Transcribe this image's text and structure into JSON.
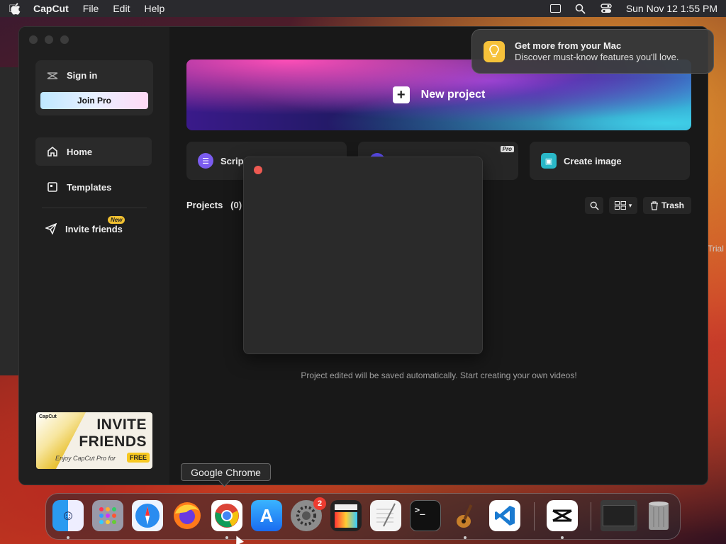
{
  "menubar": {
    "app_name": "CapCut",
    "menus": [
      "File",
      "Edit",
      "Help"
    ],
    "datetime": "Sun Nov 12  1:55 PM"
  },
  "background": {
    "trial_label": "Trial"
  },
  "sidebar": {
    "sign_in": "Sign in",
    "join_pro": "Join Pro",
    "nav": [
      {
        "label": "Home",
        "icon": "home-icon"
      },
      {
        "label": "Templates",
        "icon": "templates-icon"
      },
      {
        "label": "Invite friends",
        "icon": "send-icon",
        "badge": "New"
      }
    ],
    "banner": {
      "brand": "CapCut",
      "line1": "INVITE",
      "line2": "FRIENDS",
      "sub": "Enjoy CapCut Pro for",
      "free": "FREE"
    }
  },
  "main": {
    "new_project": "New project",
    "actions": [
      {
        "label": "Scrip",
        "icon": "script-icon",
        "color": "#7b5cf0"
      },
      {
        "label": "",
        "icon": "ai-icon",
        "color": "#5b4cf0",
        "badge": "Pro"
      },
      {
        "label": "Create image",
        "icon": "image-icon",
        "color": "#2ab8c8"
      }
    ],
    "projects_label": "Projects",
    "projects_count": "(0)",
    "trash": "Trash",
    "empty_text": "Project edited will be saved automatically. Start creating your own videos!"
  },
  "notification": {
    "title": "Get more from your Mac",
    "body": "Discover must-know features you'll love."
  },
  "tooltip": "Google Chrome",
  "dock": {
    "apps": [
      {
        "name": "finder",
        "color": "#2f8cf0"
      },
      {
        "name": "launchpad",
        "color": "#8a8a9a"
      },
      {
        "name": "safari",
        "color": "#3a9af0"
      },
      {
        "name": "firefox",
        "color": "#e86b2a"
      },
      {
        "name": "chrome",
        "color": "#ffffff"
      },
      {
        "name": "app-store",
        "color": "#1a8cf0"
      },
      {
        "name": "system-settings",
        "color": "#8a8a8a",
        "badge": "2"
      },
      {
        "name": "final-cut",
        "color": "#2a2a2a"
      },
      {
        "name": "textedit",
        "color": "#f2f2f2"
      },
      {
        "name": "terminal",
        "color": "#1a1a1a"
      },
      {
        "name": "garageband",
        "color": "#3a2a1a"
      },
      {
        "name": "vscode",
        "color": "#ffffff"
      },
      {
        "name": "capcut",
        "color": "#ffffff"
      },
      {
        "name": "downloads",
        "color": "#444"
      },
      {
        "name": "trash",
        "color": "#888"
      }
    ]
  }
}
